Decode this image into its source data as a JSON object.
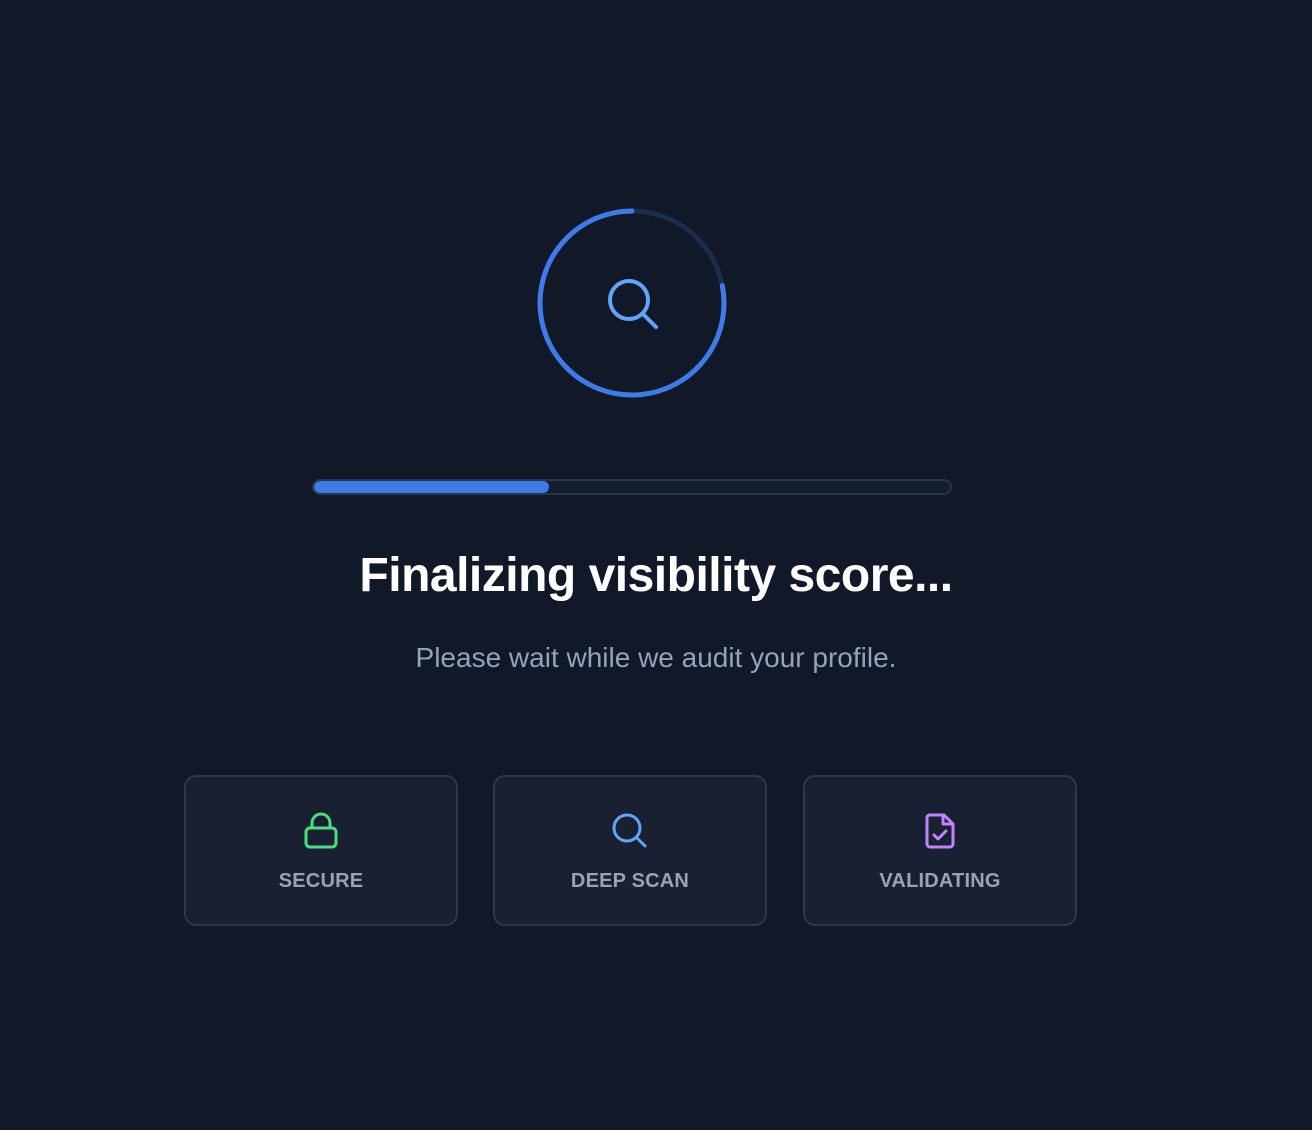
{
  "loader": {
    "progress_percent": 37,
    "spinner_arc_fraction": 0.78,
    "center_icon": "search-icon",
    "accent_color": "#3f7be8"
  },
  "title": "Finalizing visibility score...",
  "subtitle": "Please wait while we audit your profile.",
  "status_cards": [
    {
      "label": "SECURE",
      "icon": "lock-icon",
      "color": "#4ade80"
    },
    {
      "label": "DEEP SCAN",
      "icon": "search-icon",
      "color": "#60a5fa"
    },
    {
      "label": "VALIDATING",
      "icon": "file-check-icon",
      "color": "#c084fc"
    }
  ]
}
